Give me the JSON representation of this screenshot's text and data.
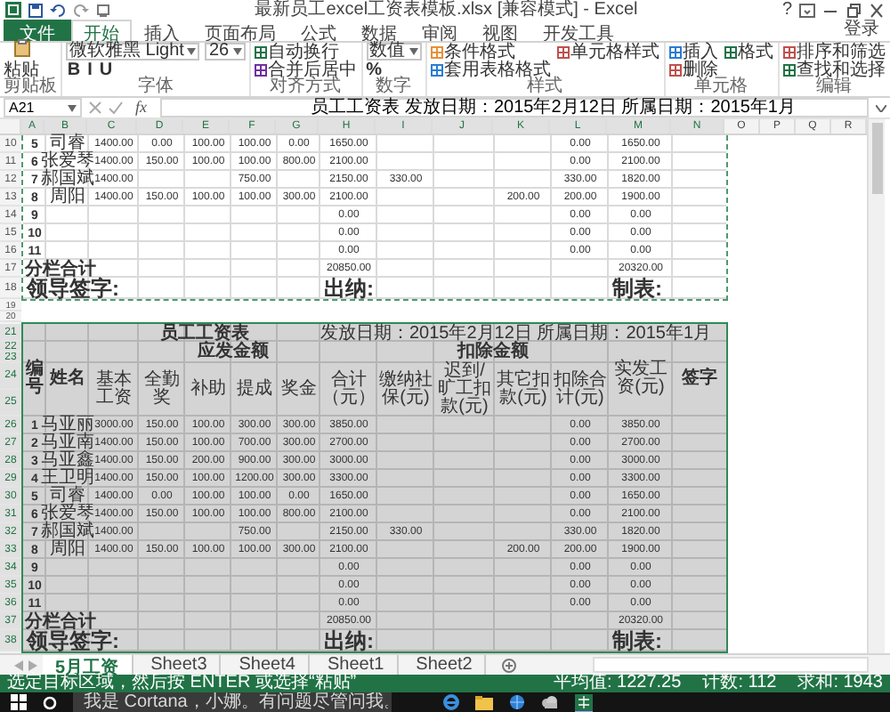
{
  "title_bar": {
    "title": "最新员工excel工资表模板.xlsx [兼容模式] - Excel",
    "help": "?"
  },
  "ribbon_tabs": [
    {
      "label": "文件",
      "kind": "file",
      "selected": false
    },
    {
      "label": "开始",
      "kind": "tab",
      "selected": true
    },
    {
      "label": "插入",
      "kind": "tab",
      "selected": false
    },
    {
      "label": "页面布局",
      "kind": "tab",
      "selected": false
    },
    {
      "label": "公式",
      "kind": "tab",
      "selected": false
    },
    {
      "label": "数据",
      "kind": "tab",
      "selected": false
    },
    {
      "label": "审阅",
      "kind": "tab",
      "selected": false
    },
    {
      "label": "视图",
      "kind": "tab",
      "selected": false
    },
    {
      "label": "开发工具",
      "kind": "tab",
      "selected": false
    }
  ],
  "sign_in": "登录",
  "ribbon_groups": [
    {
      "label": "剪贴板",
      "items": [
        {
          "kind": "big",
          "label": "粘贴"
        }
      ]
    },
    {
      "label": "字体",
      "items": [
        {
          "kind": "field",
          "value": "微软雅黑 Light"
        },
        {
          "kind": "toolbar",
          "glyphs": [
            "B",
            "I",
            "U"
          ]
        },
        {
          "kind": "field",
          "value": "26"
        }
      ]
    },
    {
      "label": "对齐方式",
      "items": [
        {
          "kind": "button",
          "label": "自动换行"
        },
        {
          "kind": "button",
          "label": "合并后居中"
        }
      ]
    },
    {
      "label": "数字",
      "items": [
        {
          "kind": "field",
          "value": "数值"
        },
        {
          "kind": "toolbar",
          "glyphs": [
            "%"
          ]
        }
      ]
    },
    {
      "label": "样式",
      "items": [
        {
          "kind": "button",
          "label": "条件格式"
        },
        {
          "kind": "button",
          "label": "套用表格格式"
        },
        {
          "kind": "button",
          "label": "单元格样式"
        }
      ]
    },
    {
      "label": "单元格",
      "items": [
        {
          "kind": "button",
          "label": "插入"
        },
        {
          "kind": "button",
          "label": "删除"
        },
        {
          "kind": "button",
          "label": "格式"
        }
      ]
    },
    {
      "label": "编辑",
      "items": [
        {
          "kind": "button",
          "label": "排序和筛选"
        },
        {
          "kind": "button",
          "label": "查找和选择"
        }
      ]
    }
  ],
  "name_box": "A21",
  "function_label": "fx",
  "formula": "员工工资表  发放日期：2015年2月12日  所属日期：2015年1月",
  "sheet": {
    "columns": [
      {
        "label": "A",
        "selected": true
      },
      {
        "label": "B",
        "selected": true
      },
      {
        "label": "C",
        "selected": true
      },
      {
        "label": "D",
        "selected": true
      },
      {
        "label": "E",
        "selected": true
      },
      {
        "label": "F",
        "selected": true
      },
      {
        "label": "G",
        "selected": true
      },
      {
        "label": "H",
        "selected": true
      },
      {
        "label": "I",
        "selected": true
      },
      {
        "label": "J",
        "selected": true
      },
      {
        "label": "K",
        "selected": true
      },
      {
        "label": "L",
        "selected": true
      },
      {
        "label": "M",
        "selected": true
      },
      {
        "label": "N",
        "selected": true
      },
      {
        "label": "O",
        "selected": false
      },
      {
        "label": "P",
        "selected": false
      },
      {
        "label": "Q",
        "selected": false
      },
      {
        "label": "R",
        "selected": false
      }
    ],
    "blocks": [
      {
        "kind": "print_area",
        "selected": false,
        "rows": [
          {
            "number": "10",
            "kind": "data",
            "cells": {
              "A": "5",
              "B": "司睿",
              "C": "1400.00",
              "D": "0.00",
              "E": "100.00",
              "F": "100.00",
              "G": "0.00",
              "H": "1650.00",
              "L": "0.00",
              "M": "1650.00"
            }
          },
          {
            "number": "11",
            "kind": "data",
            "cells": {
              "A": "6",
              "B": "张爱琴",
              "C": "1400.00",
              "D": "150.00",
              "E": "100.00",
              "F": "100.00",
              "G": "800.00",
              "H": "2100.00",
              "L": "0.00",
              "M": "2100.00"
            }
          },
          {
            "number": "12",
            "kind": "data",
            "cells": {
              "A": "7",
              "B": "郝国斌",
              "C": "1400.00",
              "F": "750.00",
              "H": "2150.00",
              "I": "330.00",
              "L": "330.00",
              "M": "1820.00"
            }
          },
          {
            "number": "13",
            "kind": "data",
            "cells": {
              "A": "8",
              "B": "周阳",
              "C": "1400.00",
              "D": "150.00",
              "E": "100.00",
              "F": "100.00",
              "G": "300.00",
              "H": "2100.00",
              "K": "200.00",
              "L": "200.00",
              "M": "1900.00"
            }
          },
          {
            "number": "14",
            "kind": "data",
            "cells": {
              "A": "9",
              "H": "0.00",
              "L": "0.00",
              "M": "0.00"
            }
          },
          {
            "number": "15",
            "kind": "data",
            "cells": {
              "A": "10",
              "H": "0.00",
              "L": "0.00",
              "M": "0.00"
            }
          },
          {
            "number": "16",
            "kind": "data",
            "cells": {
              "A": "11",
              "H": "0.00",
              "L": "0.00",
              "M": "0.00"
            }
          },
          {
            "number": "17",
            "kind": "total",
            "cells": {
              "A": "分栏合计",
              "H": "20850.00",
              "M": "20320.00"
            }
          },
          {
            "number": "18",
            "kind": "signature",
            "cells": {
              "A": "领导签字:",
              "H": "出纳:",
              "M": "制表:"
            }
          }
        ]
      },
      {
        "kind": "gap",
        "selected": false,
        "rows": [
          {
            "number": "19",
            "kind": "blank"
          },
          {
            "number": "20",
            "kind": "blank"
          }
        ]
      },
      {
        "kind": "range",
        "selected": true,
        "rows": [
          {
            "number": "21",
            "kind": "title",
            "cells": {
              "C": "员工工资表",
              "H": "发放日期：2015年2月12日  所属日期：2015年1月"
            }
          },
          {
            "kind": "header",
            "row_numbers": [
              "22",
              "23",
              "24",
              "25"
            ],
            "number_label": "编号",
            "name_label": "姓名",
            "groups": [
              {
                "label": "应发金额",
                "columns": [
                  "基本工资",
                  "全勤奖",
                  "补助",
                  "提成",
                  "奖金",
                  "合计（元）"
                ]
              },
              {
                "label": "扣除金额",
                "columns": [
                  "缴纳社保(元)",
                  "迟到/旷工扣款(元)",
                  "其它扣款(元)",
                  "扣除合计(元)"
                ]
              }
            ],
            "net_label": "实发工资(元)",
            "sign_label": "签字"
          },
          {
            "number": "26",
            "kind": "data",
            "cells": {
              "A": "1",
              "B": "马亚丽",
              "C": "3000.00",
              "D": "150.00",
              "E": "100.00",
              "F": "300.00",
              "G": "300.00",
              "H": "3850.00",
              "L": "0.00",
              "M": "3850.00"
            }
          },
          {
            "number": "27",
            "kind": "data",
            "cells": {
              "A": "2",
              "B": "马亚南",
              "C": "1400.00",
              "D": "150.00",
              "E": "100.00",
              "F": "700.00",
              "G": "300.00",
              "H": "2700.00",
              "L": "0.00",
              "M": "2700.00"
            }
          },
          {
            "number": "28",
            "kind": "data",
            "cells": {
              "A": "3",
              "B": "马亚鑫",
              "C": "1400.00",
              "D": "150.00",
              "E": "200.00",
              "F": "900.00",
              "G": "300.00",
              "H": "3000.00",
              "L": "0.00",
              "M": "3000.00"
            }
          },
          {
            "number": "29",
            "kind": "data",
            "cells": {
              "A": "4",
              "B": "王卫明",
              "C": "1400.00",
              "D": "150.00",
              "E": "100.00",
              "F": "1200.00",
              "G": "300.00",
              "H": "3300.00",
              "L": "0.00",
              "M": "3300.00"
            }
          },
          {
            "number": "30",
            "kind": "data",
            "cells": {
              "A": "5",
              "B": "司睿",
              "C": "1400.00",
              "D": "0.00",
              "E": "100.00",
              "F": "100.00",
              "G": "0.00",
              "H": "1650.00",
              "L": "0.00",
              "M": "1650.00"
            }
          },
          {
            "number": "31",
            "kind": "data",
            "cells": {
              "A": "6",
              "B": "张爱琴",
              "C": "1400.00",
              "D": "150.00",
              "E": "100.00",
              "F": "100.00",
              "G": "800.00",
              "H": "2100.00",
              "L": "0.00",
              "M": "2100.00"
            }
          },
          {
            "number": "32",
            "kind": "data",
            "cells": {
              "A": "7",
              "B": "郝国斌",
              "C": "1400.00",
              "F": "750.00",
              "H": "2150.00",
              "I": "330.00",
              "L": "330.00",
              "M": "1820.00"
            }
          },
          {
            "number": "33",
            "kind": "data",
            "cells": {
              "A": "8",
              "B": "周阳",
              "C": "1400.00",
              "D": "150.00",
              "E": "100.00",
              "F": "100.00",
              "G": "300.00",
              "H": "2100.00",
              "K": "200.00",
              "L": "200.00",
              "M": "1900.00"
            }
          },
          {
            "number": "34",
            "kind": "data",
            "cells": {
              "A": "9",
              "H": "0.00",
              "L": "0.00",
              "M": "0.00"
            }
          },
          {
            "number": "35",
            "kind": "data",
            "cells": {
              "A": "10",
              "H": "0.00",
              "L": "0.00",
              "M": "0.00"
            }
          },
          {
            "number": "36",
            "kind": "data",
            "cells": {
              "A": "11",
              "H": "0.00",
              "L": "0.00",
              "M": "0.00"
            }
          },
          {
            "number": "37",
            "kind": "total",
            "cells": {
              "A": "分栏合计",
              "H": "20850.00",
              "M": "20320.00"
            }
          },
          {
            "number": "38",
            "kind": "signature",
            "cells": {
              "A": "领导签字:",
              "H": "出纳:",
              "M": "制表:"
            }
          }
        ]
      }
    ]
  },
  "sheet_tabs": [
    {
      "label": "5月工资",
      "selected": true
    },
    {
      "label": "Sheet3",
      "selected": false
    },
    {
      "label": "Sheet4",
      "selected": false
    },
    {
      "label": "Sheet1",
      "selected": false
    },
    {
      "label": "Sheet2",
      "selected": false
    }
  ],
  "status": {
    "message": "选定目标区域，然后按 ENTER 或选择“粘贴”",
    "stats": [
      "平均值: 1227.25",
      "计数: 112",
      "求和: 1943"
    ]
  },
  "taskbar": {
    "search_placeholder": "我是 Cortana，小娜。有问题尽管问我。"
  }
}
